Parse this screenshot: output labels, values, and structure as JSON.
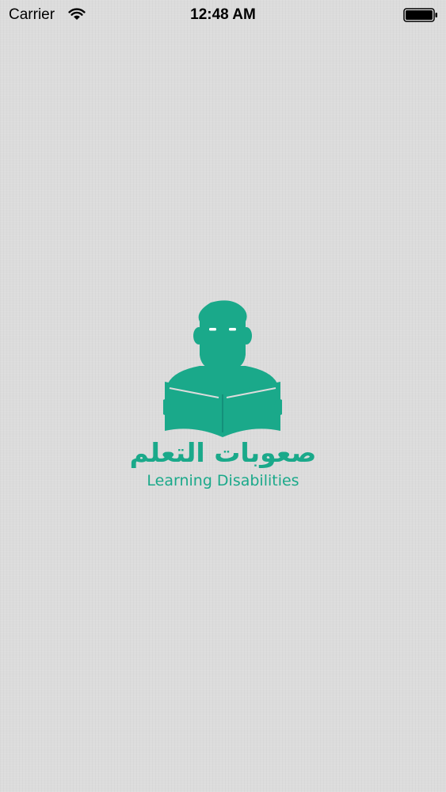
{
  "status_bar": {
    "carrier": "Carrier",
    "time": "12:48 AM",
    "wifi_icon": "wifi-icon",
    "battery_icon": "battery-icon",
    "battery_level": 1.0
  },
  "splash": {
    "logo_icon": "reader-with-book-icon",
    "arabic_title": "صعوبات التعلم",
    "english_title": "Learning Disabilities",
    "brand_color": "#1aa98a",
    "background_color": "#dcdcdc"
  }
}
